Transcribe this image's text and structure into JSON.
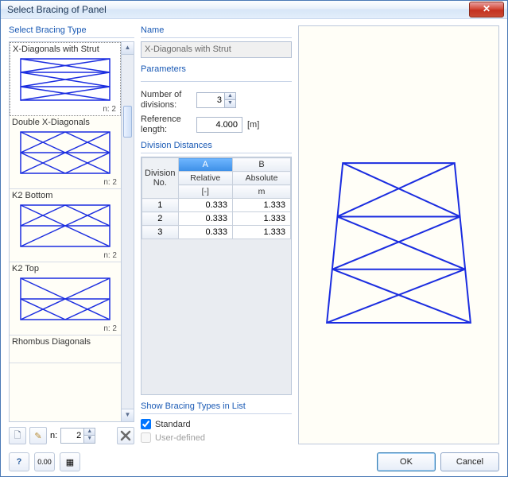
{
  "window": {
    "title": "Select Bracing of Panel"
  },
  "left": {
    "group_label": "Select Bracing Type",
    "items": [
      {
        "title": "X-Diagonals with Strut",
        "n_label": "n: 2"
      },
      {
        "title": "Double X-Diagonals",
        "n_label": "n: 2"
      },
      {
        "title": "K2 Bottom",
        "n_label": "n: 2"
      },
      {
        "title": "K2 Top",
        "n_label": "n: 2"
      },
      {
        "title": "Rhombus Diagonals",
        "n_label": ""
      }
    ],
    "toolbar": {
      "n_label": "n:",
      "n_value": "2"
    }
  },
  "name": {
    "group_label": "Name",
    "value": "X-Diagonals with Strut"
  },
  "parameters": {
    "group_label": "Parameters",
    "divisions_label": "Number of divisions:",
    "divisions_value": "3",
    "reflen_label": "Reference length:",
    "reflen_value": "4.000",
    "reflen_unit": "[m]"
  },
  "table": {
    "group_label": "Division Distances",
    "col_a": "A",
    "col_b": "B",
    "rowhdr": "Division No.",
    "sub_a": "Relative",
    "sub_b": "Absolute",
    "unit_a": "[-]",
    "unit_b": "m",
    "rows": [
      {
        "no": "1",
        "rel": "0.333",
        "abs": "1.333"
      },
      {
        "no": "2",
        "rel": "0.333",
        "abs": "1.333"
      },
      {
        "no": "3",
        "rel": "0.333",
        "abs": "1.333"
      }
    ]
  },
  "showtypes": {
    "group_label": "Show Bracing Types in List",
    "standard": "Standard",
    "userdef": "User-defined"
  },
  "buttons": {
    "ok": "OK",
    "cancel": "Cancel"
  }
}
